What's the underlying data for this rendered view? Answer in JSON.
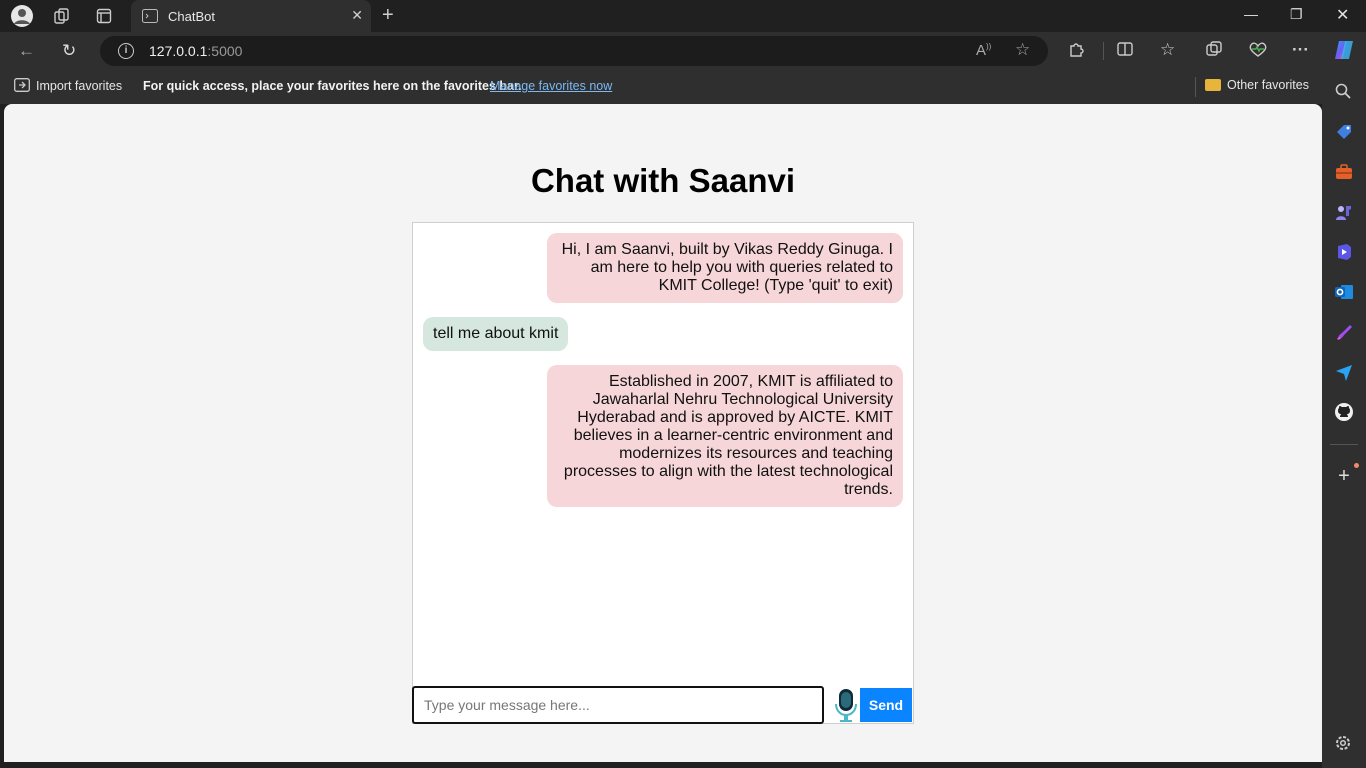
{
  "browser": {
    "tab_title": "ChatBot",
    "url_host": "127.0.0.1",
    "url_port": ":5000",
    "window_controls": [
      "minimize",
      "restore",
      "close"
    ]
  },
  "favorites_bar": {
    "import_label": "Import favorites",
    "message": "For quick access, place your favorites here on the favorites bar.",
    "manage_link": "Manage favorites now",
    "other_label": "Other favorites"
  },
  "page": {
    "title": "Chat with Saanvi",
    "messages": [
      {
        "sender": "bot",
        "text": "Hi, I am Saanvi, built by Vikas Reddy Ginuga. I am here to help you with queries related to KMIT College! (Type 'quit' to exit)"
      },
      {
        "sender": "user",
        "text": "tell me about kmit"
      },
      {
        "sender": "bot",
        "text": "Established in 2007, KMIT is affiliated to Jawaharlal Nehru Technological University Hyderabad and is approved by AICTE. KMIT believes in a learner-centric environment and modernizes its resources and teaching processes to align with the latest technological trends."
      }
    ],
    "input_placeholder": "Type your message here...",
    "send_label": "Send"
  },
  "colors": {
    "bot_bubble": "#f6d6d8",
    "user_bubble": "#d6e7e0",
    "send_button": "#0a84ff"
  },
  "icons": [
    "profile-icon",
    "workspaces-icon",
    "tab-actions-icon",
    "back-icon",
    "refresh-icon",
    "read-aloud-icon",
    "favorite-star-icon",
    "extensions-icon",
    "split-screen-icon",
    "favorites-icon",
    "collections-icon",
    "performance-icon",
    "more-icon",
    "copilot-icon",
    "search-icon",
    "shopping-icon",
    "tools-icon",
    "games-icon",
    "microsoft365-icon",
    "outlook-icon",
    "designer-icon",
    "drop-icon",
    "github-icon",
    "add-icon",
    "settings-icon",
    "microphone-icon"
  ]
}
